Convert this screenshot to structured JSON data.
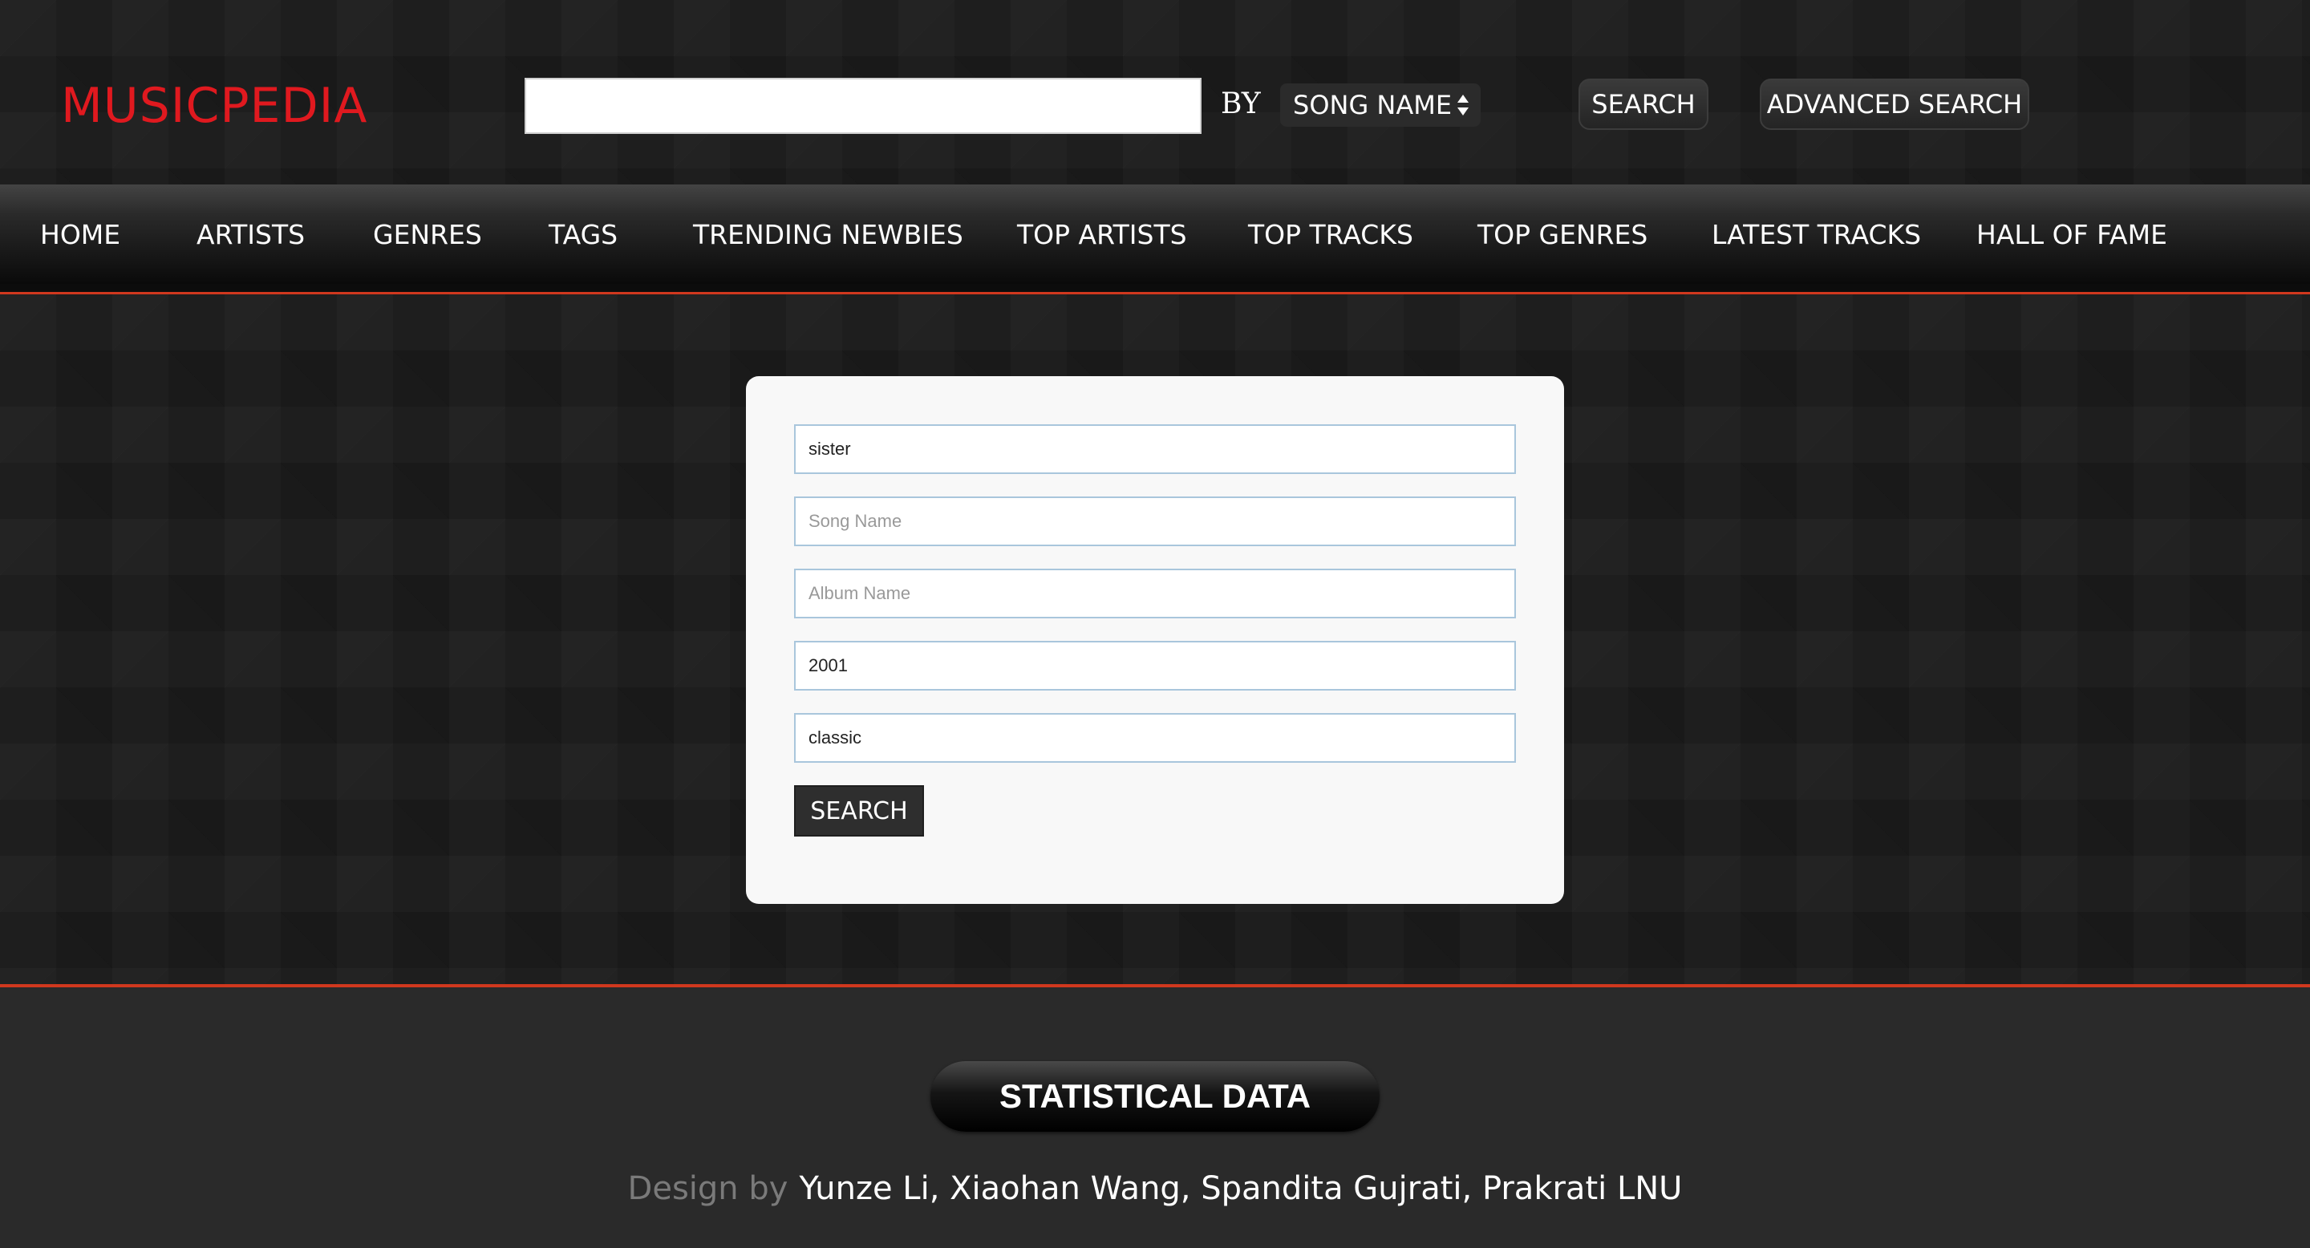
{
  "header": {
    "logo": "MUSICPEDIA",
    "search_value": "",
    "by_label": "BY",
    "search_by_selected": "SONG NAME",
    "search_button": "SEARCH",
    "advanced_search_button": "ADVANCED SEARCH"
  },
  "nav": {
    "items": [
      {
        "label": "HOME"
      },
      {
        "label": "ARTISTS"
      },
      {
        "label": "GENRES"
      },
      {
        "label": "TAGS"
      },
      {
        "label": "TRENDING NEWBIES"
      },
      {
        "label": "TOP ARTISTS"
      },
      {
        "label": "TOP TRACKS"
      },
      {
        "label": "TOP GENRES"
      },
      {
        "label": "LATEST TRACKS"
      },
      {
        "label": "HALL OF FAME"
      }
    ]
  },
  "advanced_form": {
    "fields": [
      {
        "value": "sister",
        "placeholder": ""
      },
      {
        "value": "",
        "placeholder": "Song Name"
      },
      {
        "value": "",
        "placeholder": "Album Name"
      },
      {
        "value": "2001",
        "placeholder": ""
      },
      {
        "value": "classic",
        "placeholder": ""
      }
    ],
    "search_button": "SEARCH"
  },
  "footer": {
    "statistical_button": "STATISTICAL DATA",
    "credits_label": "Design by",
    "credits_names": "Yunze Li, Xiaohan Wang, Spandita Gujrati, Prakrati LNU"
  },
  "colors": {
    "logo": "#e0191f",
    "accent_line": "#d0381e",
    "card_bg": "#f8f8f8",
    "field_border": "#a9c6dc"
  },
  "icons": {
    "select_arrows": "updown-arrows-icon"
  }
}
